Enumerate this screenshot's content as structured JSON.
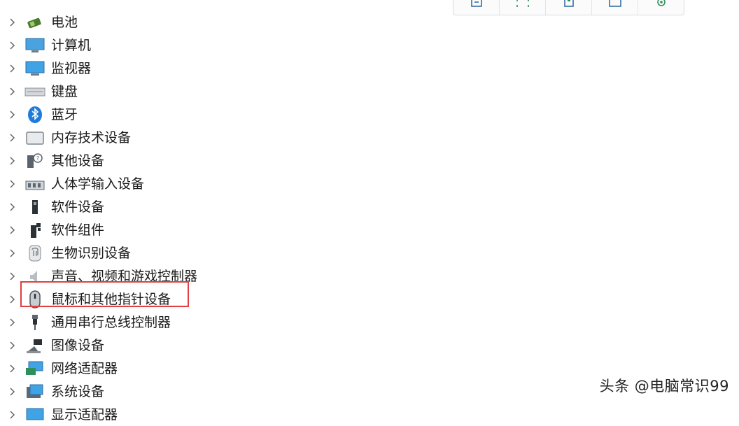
{
  "device_tree": {
    "items": [
      {
        "label": "电池",
        "icon": "battery-icon"
      },
      {
        "label": "计算机",
        "icon": "computer-icon"
      },
      {
        "label": "监视器",
        "icon": "monitor-icon"
      },
      {
        "label": "键盘",
        "icon": "keyboard-icon"
      },
      {
        "label": "蓝牙",
        "icon": "bluetooth-icon"
      },
      {
        "label": "内存技术设备",
        "icon": "memory-device-icon"
      },
      {
        "label": "其他设备",
        "icon": "other-device-icon"
      },
      {
        "label": "人体学输入设备",
        "icon": "hid-icon"
      },
      {
        "label": "软件设备",
        "icon": "software-device-icon"
      },
      {
        "label": "软件组件",
        "icon": "software-component-icon"
      },
      {
        "label": "生物识别设备",
        "icon": "fingerprint-icon"
      },
      {
        "label": "声音、视频和游戏控制器",
        "icon": "speaker-icon"
      },
      {
        "label": "鼠标和其他指针设备",
        "icon": "mouse-icon"
      },
      {
        "label": "通用串行总线控制器",
        "icon": "usb-icon"
      },
      {
        "label": "图像设备",
        "icon": "camera-icon"
      },
      {
        "label": "网络适配器",
        "icon": "network-adapter-icon"
      },
      {
        "label": "系统设备",
        "icon": "system-device-icon"
      },
      {
        "label": "显示适配器",
        "icon": "display-adapter-icon"
      }
    ]
  },
  "toolbar": {
    "buttons": [
      "properties-icon",
      "scan-icon",
      "update-driver-icon",
      "display-icon",
      "settings-icon"
    ]
  },
  "watermark": "头条 @电脑常识99",
  "colors": {
    "highlight": "#e0403f",
    "accent": "#1f7bd8"
  }
}
